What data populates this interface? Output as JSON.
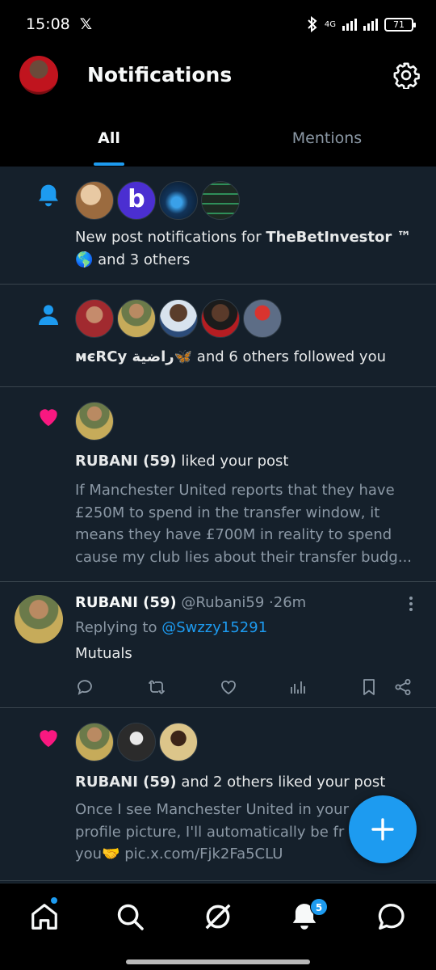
{
  "status_bar": {
    "time": "15:08",
    "x_logo": "𝕏",
    "network": "4G",
    "battery": "71"
  },
  "header": {
    "title": "Notifications"
  },
  "tabs": [
    {
      "label": "All"
    },
    {
      "label": "Mentions"
    }
  ],
  "notifications": [
    {
      "type": "bell-icon",
      "text_prefix": "New post notifications for ",
      "bold_name": "TheBetInvestor ™",
      "text_suffix": "🌎 and 3 others",
      "avatar_b_letter": "b"
    },
    {
      "type": "person-icon",
      "name_text": "ᴍєRCу راضية🦋",
      "text_suffix": " and 6 others followed you"
    },
    {
      "type": "heart-icon",
      "bold_name": "RUBANI (59)",
      "text_suffix": " liked your post",
      "snippet_lines": [
        "If Manchester United reports that they have",
        "£250M to spend in the transfer window, it",
        "means they have £700M in reality to spend",
        "cause my club lies about their transfer budg..."
      ]
    },
    {
      "type": "post",
      "name": "RUBANI (59)",
      "handle": "@Rubani59",
      "separator": "·",
      "time": "26m",
      "replying_prefix": "Replying to ",
      "replying_to": "@Swzzy15291",
      "body": "Mutuals"
    },
    {
      "type": "heart-icon",
      "bold_name": "RUBANI (59)",
      "text_suffix": " and 2 others liked your post",
      "snippet_lines": [
        "Once I see Manchester United in your",
        "profile picture, I'll automatically be fr",
        "you🤝 pic.x.com/Fjk2Fa5CLU"
      ],
      "snippet_tail": "h"
    }
  ],
  "bottom_nav": {
    "notification_count": "5"
  },
  "colors": {
    "accent": "#1d9bf0",
    "like": "#f91880",
    "background": "#15202b"
  }
}
